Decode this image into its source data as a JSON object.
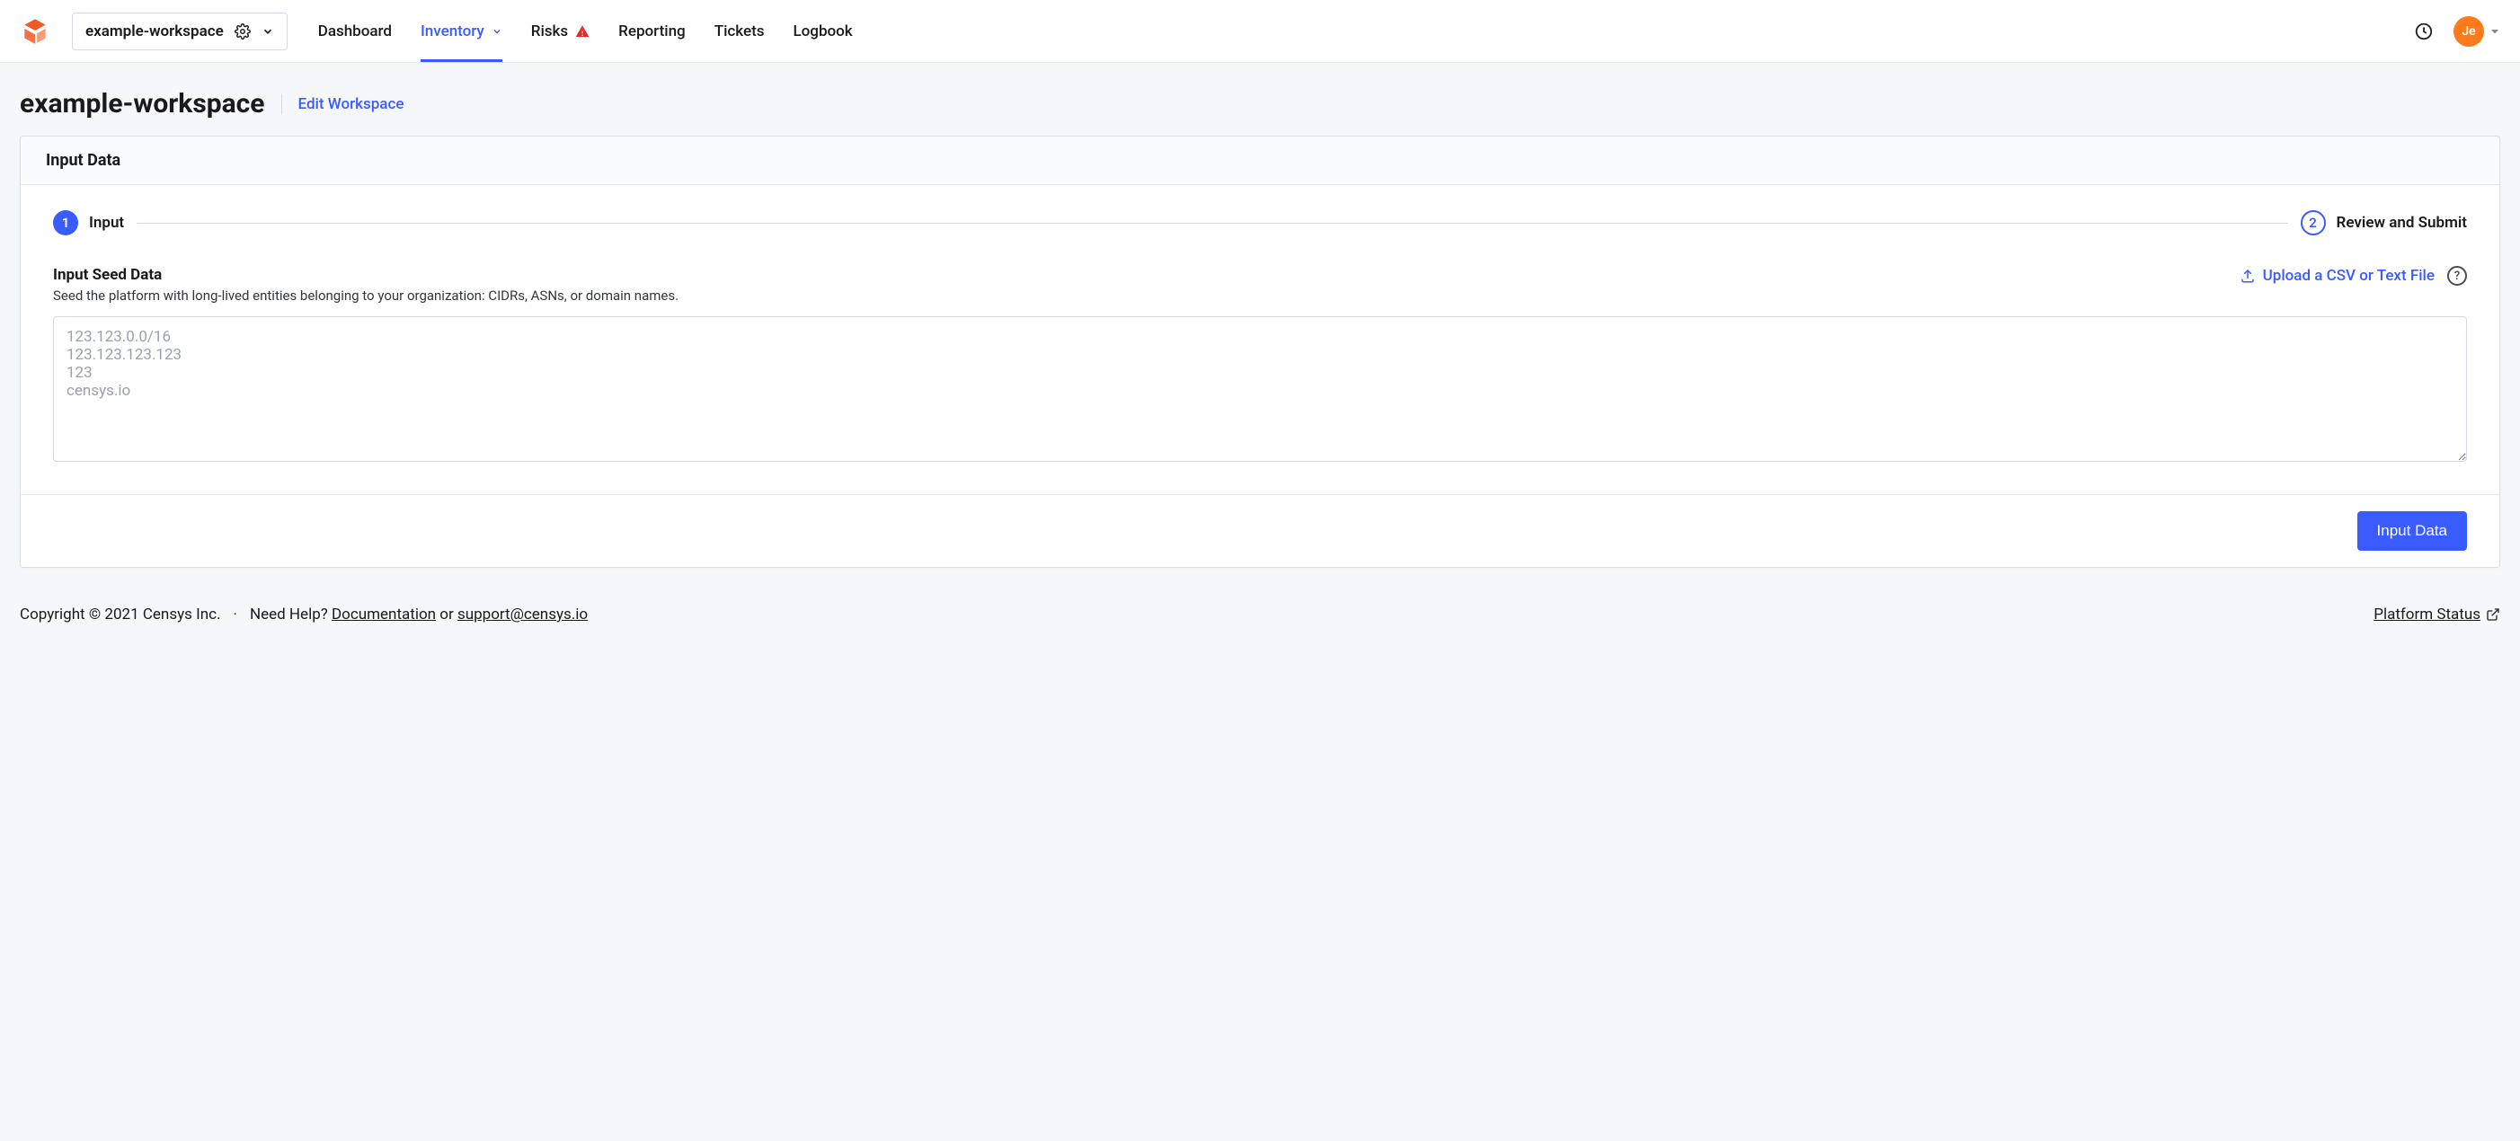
{
  "header": {
    "workspace_name": "example-workspace",
    "nav": {
      "dashboard": "Dashboard",
      "inventory": "Inventory",
      "risks": "Risks",
      "reporting": "Reporting",
      "tickets": "Tickets",
      "logbook": "Logbook"
    },
    "avatar_initials": "Je"
  },
  "page": {
    "title": "example-workspace",
    "edit_link": "Edit Workspace"
  },
  "card": {
    "title": "Input Data",
    "step1_label": "Input",
    "step2_label": "Review and Submit",
    "seed_title": "Input Seed Data",
    "seed_desc": "Seed the platform with long-lived entities belonging to your organization: CIDRs, ASNs, or domain names.",
    "upload_label": "Upload a CSV or Text File",
    "textarea_placeholder": "123.123.0.0/16\n123.123.123.123\n123\ncensys.io",
    "submit_label": "Input Data"
  },
  "footer": {
    "copyright": "Copyright © 2021 Censys Inc.",
    "need_help": "Need Help?",
    "doc_link": "Documentation",
    "or": "or",
    "support_link": "support@censys.io",
    "status_link": "Platform Status"
  }
}
